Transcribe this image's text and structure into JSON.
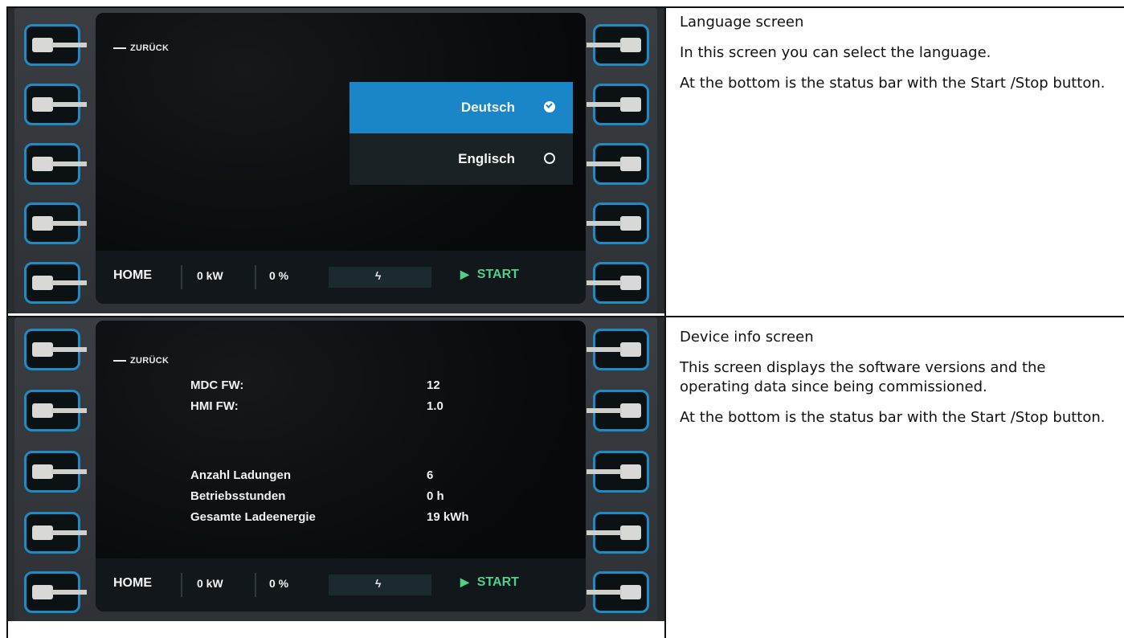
{
  "panels": [
    {
      "screen": {
        "back_label": "ZURÜCK",
        "languages": [
          {
            "label": "Deutsch",
            "selected": true
          },
          {
            "label": "Englisch",
            "selected": false
          }
        ],
        "status": {
          "home": "HOME",
          "power": "0 kW",
          "percent": "0 %",
          "bolt_icon": "lightning-icon",
          "start": "START"
        }
      },
      "desc": {
        "title": "Language screen",
        "paragraphs": [
          "In this screen you can select the language.",
          "At the bottom is the status bar with the Start /Stop button."
        ]
      }
    },
    {
      "screen": {
        "back_label": "ZURÜCK",
        "info_rows": [
          {
            "label": "MDC FW:",
            "value": "12"
          },
          {
            "label": "HMI FW:",
            "value": "1.0"
          },
          {
            "label": "Anzahl Ladungen",
            "value": "6"
          },
          {
            "label": "Betriebsstunden",
            "value": "0 h"
          },
          {
            "label": "Gesamte Ladeenergie",
            "value": "19 kWh"
          }
        ],
        "status": {
          "home": "HOME",
          "power": "0 kW",
          "percent": "0 %",
          "bolt_icon": "lightning-icon",
          "start": "START"
        }
      },
      "desc": {
        "title": "Device info screen",
        "paragraphs": [
          "This screen displays the software versions and the operating data since being commissioned.",
          "At the bottom is the status bar with the Start /Stop button."
        ]
      }
    }
  ],
  "colors": {
    "accent": "#1a86c7",
    "frame": "#1f8bc4",
    "start": "#4ed08a"
  }
}
